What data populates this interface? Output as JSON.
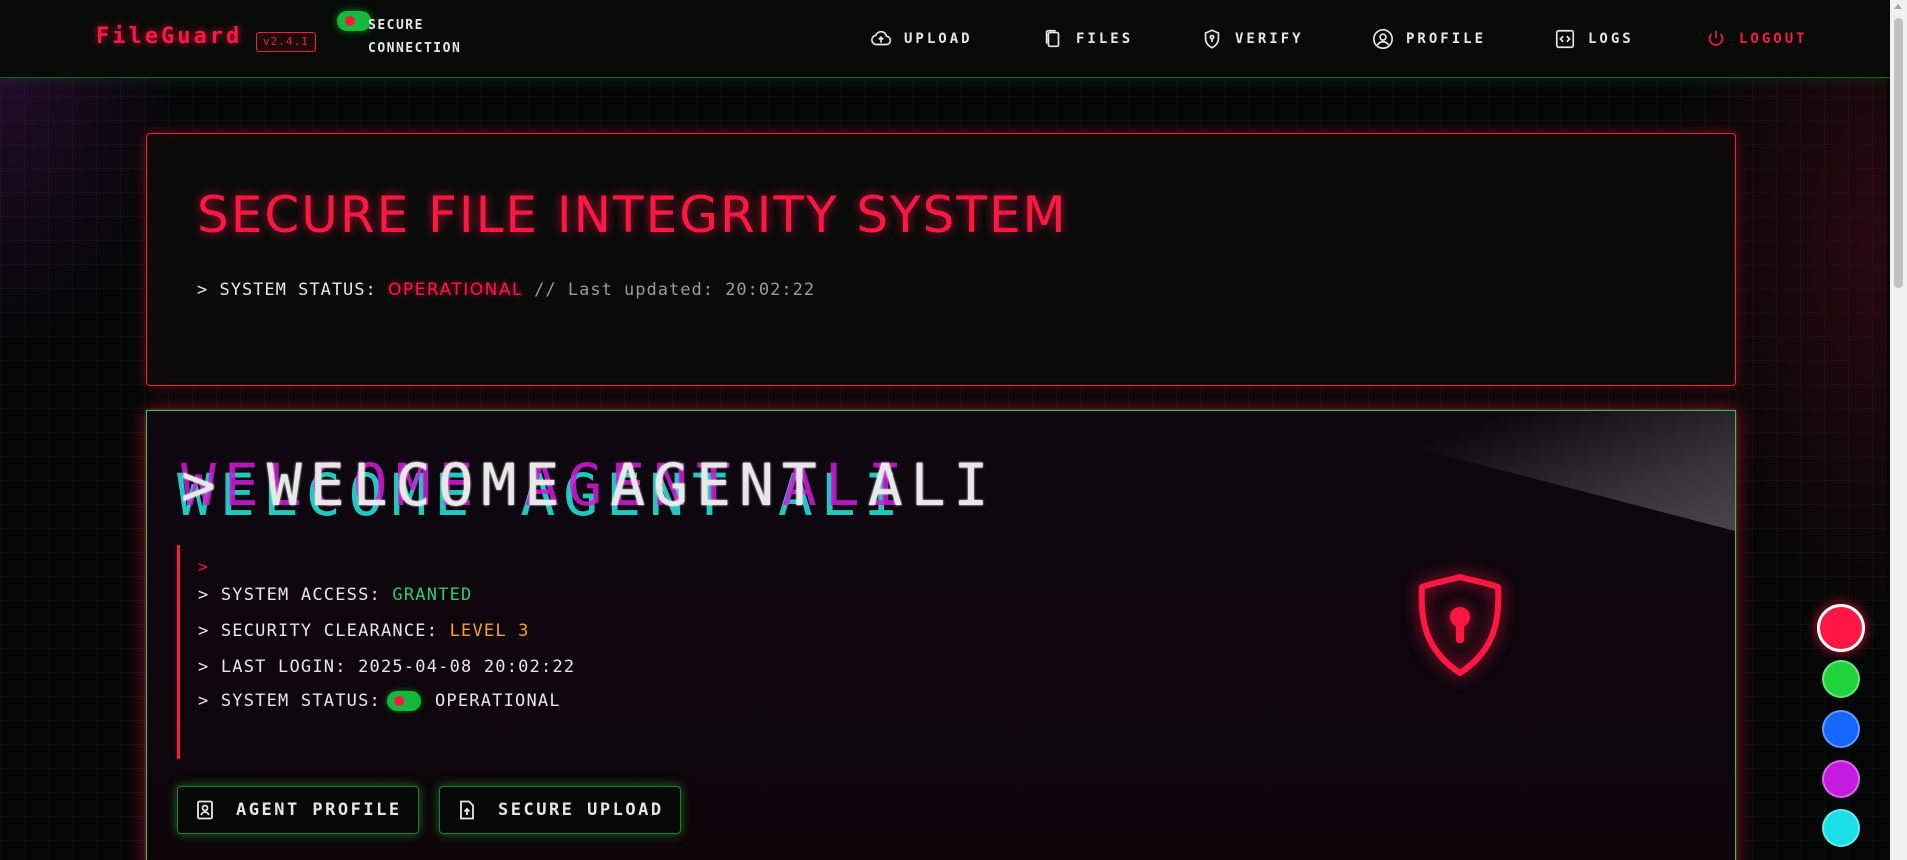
{
  "navbar": {
    "brand": "FileGuard",
    "version": "v2.4.1",
    "secure_connection_label": "SECURE CONNECTION",
    "links": [
      {
        "label": "UPLOAD",
        "icon": "cloud-upload-icon"
      },
      {
        "label": "FILES",
        "icon": "files-icon"
      },
      {
        "label": "VERIFY",
        "icon": "shield-check-icon"
      },
      {
        "label": "PROFILE",
        "icon": "user-circle-icon"
      },
      {
        "label": "LOGS",
        "icon": "code-icon"
      },
      {
        "label": "LOGOUT",
        "icon": "power-icon"
      }
    ]
  },
  "hero": {
    "title": "SECURE FILE INTEGRITY SYSTEM",
    "status_prefix": "> SYSTEM STATUS:",
    "status_value": "OPERATIONAL",
    "updated_prefix": "// Last updated:",
    "updated_time": "20:02:22"
  },
  "welcome": {
    "headline": "WELCOME AGENT ALI",
    "headline_typed": "> WELCOME AGENT ALI",
    "prompt": ">",
    "lines": {
      "access_label": "> SYSTEM ACCESS:",
      "access_value": "GRANTED",
      "clearance_label": "> SECURITY CLEARANCE:",
      "clearance_value": "LEVEL 3",
      "login_label": "> LAST LOGIN:",
      "login_value": "2025-04-08 20:02:22",
      "status_label": "> SYSTEM STATUS:",
      "status_value": "OPERATIONAL"
    },
    "buttons": {
      "profile": "AGENT PROFILE",
      "upload": "SECURE UPLOAD"
    }
  },
  "theme_colors": [
    "#ff1744",
    "#1fd43a",
    "#1565ff",
    "#c41ae0",
    "#18e0e6"
  ],
  "colors": {
    "accent_red": "#ff1744",
    "accent_green": "#35c14a",
    "status_green": "#2ecc71",
    "warning_orange": "#ff9f1a"
  }
}
